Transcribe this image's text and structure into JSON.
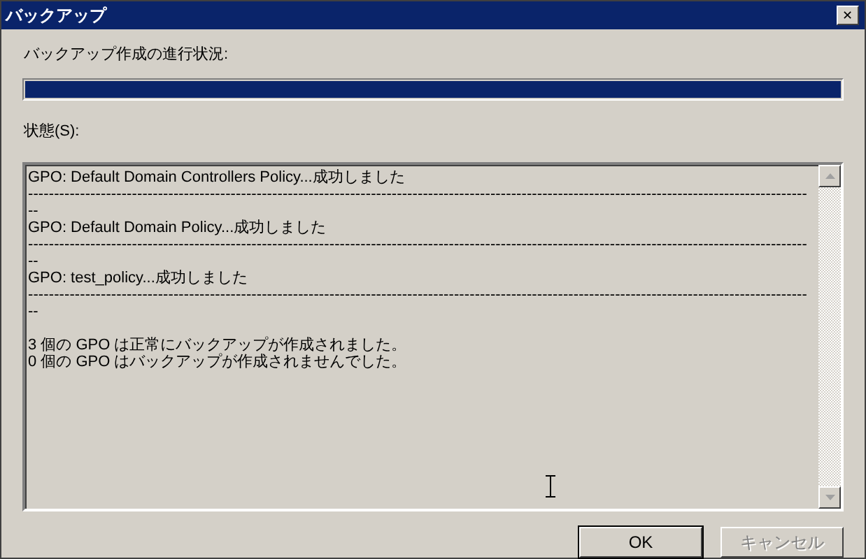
{
  "window": {
    "title": "バックアップ",
    "close": "✕"
  },
  "progress": {
    "label": "バックアップ作成の進行状況:",
    "level": 1
  },
  "status": {
    "label": "状態(S):",
    "lines": [
      {
        "kind": "text",
        "text": "GPO: Default Domain Controllers Policy...成功しました"
      },
      {
        "kind": "rule",
        "text": "------------------------------------------------------------------------------------------------------------------------------------------------------"
      },
      {
        "kind": "text",
        "text": "--"
      },
      {
        "kind": "text",
        "text": "GPO: Default Domain Policy...成功しました"
      },
      {
        "kind": "rule",
        "text": "------------------------------------------------------------------------------------------------------------------------------------------------------"
      },
      {
        "kind": "text",
        "text": "--"
      },
      {
        "kind": "text",
        "text": "GPO: test_policy...成功しました"
      },
      {
        "kind": "rule",
        "text": "------------------------------------------------------------------------------------------------------------------------------------------------------"
      },
      {
        "kind": "text",
        "text": "--"
      },
      {
        "kind": "blank"
      },
      {
        "kind": "text",
        "text": "3 個の GPO は正常にバックアップが作成されました。"
      },
      {
        "kind": "text",
        "text": "0 個の GPO はバックアップが作成されませんでした。"
      }
    ]
  },
  "buttons": [
    {
      "label": "OK",
      "disabled": false
    },
    {
      "label": "キャンセル",
      "disabled": true
    }
  ]
}
